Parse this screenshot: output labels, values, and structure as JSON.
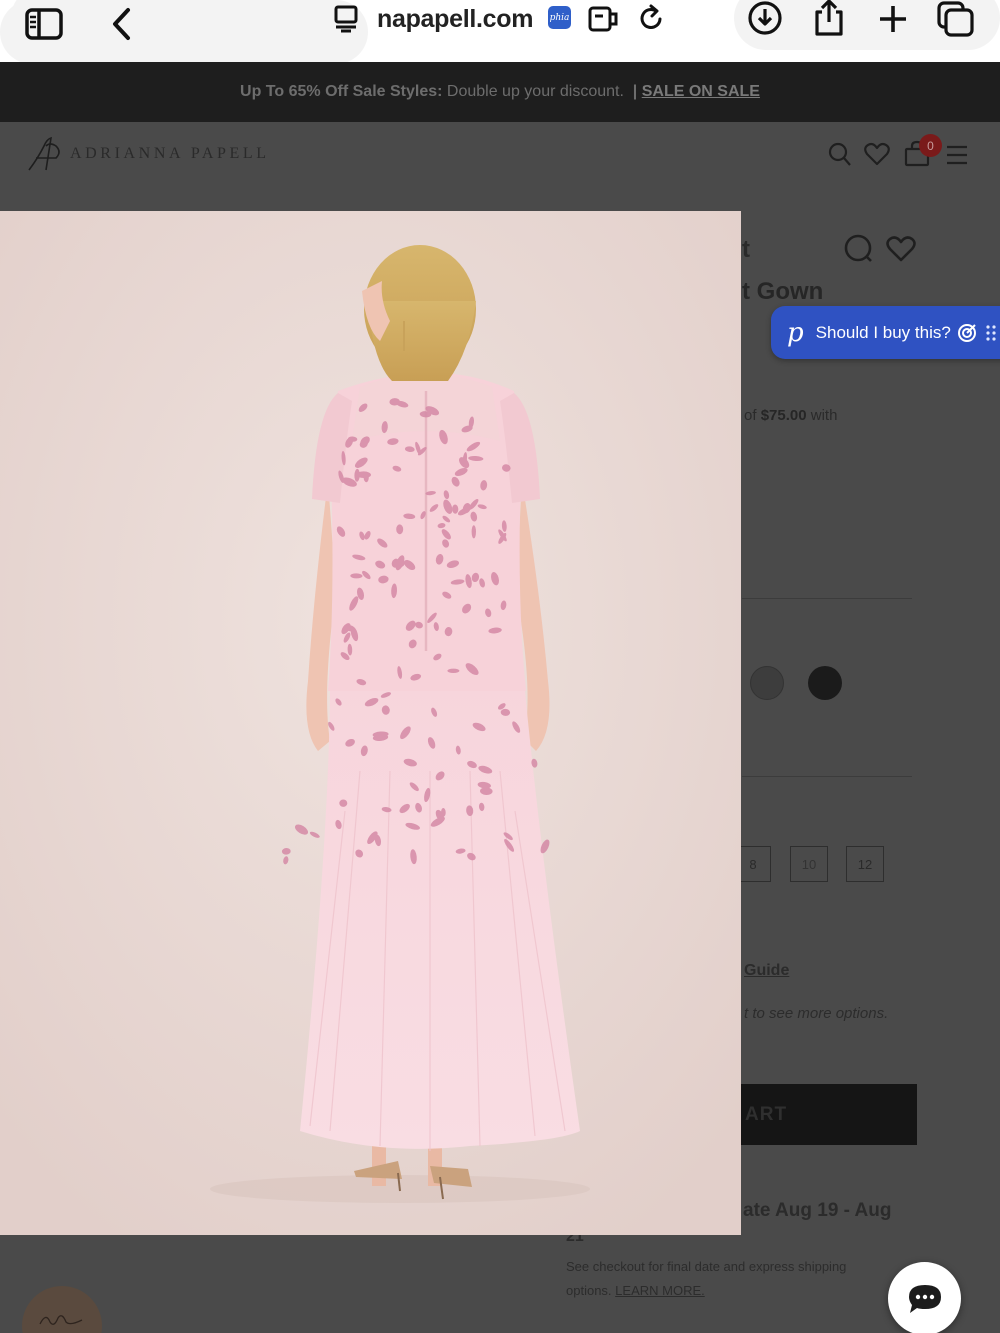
{
  "browser": {
    "url": "napapell.com",
    "extension_badge": "phia"
  },
  "promo": {
    "bold": "Up To 65% Off Sale Styles:",
    "text": "Double up your discount.",
    "separator": "|",
    "link": "SALE ON SALE"
  },
  "header": {
    "brand": "ADRIANNA PAPELL",
    "cart_count": "0"
  },
  "product": {
    "title_fragment_1": "t",
    "title_fragment_2": "t Gown",
    "price_fragment_prefix": "of ",
    "price_fragment_value": "$75.00",
    "price_fragment_suffix": " with",
    "sizes": [
      "8",
      "10",
      "12"
    ],
    "size_guide_fragment": "Guide",
    "options_fragment": "t to see more options.",
    "add_to_cart_fragment": "ART",
    "delivery_fragment": "ate Aug 19 - Aug",
    "delivery_fragment_2": "21",
    "shipping_note": "See checkout for final date and express shipping options.",
    "learn_more": "LEARN MORE."
  },
  "phia": {
    "logo": "p",
    "prompt": "Should I buy this?"
  },
  "colors": {
    "promo_bg": "#1e1e1e",
    "overlay_bg": "#4a4a4a",
    "phia_blue": "#2f52c2",
    "image_bg": "#ead9d5",
    "dress_pink": "#f6d9de",
    "beading_pink": "#d58aa6"
  }
}
